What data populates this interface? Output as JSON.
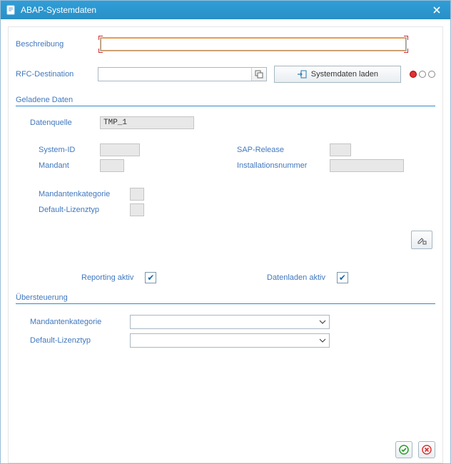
{
  "title": "ABAP-Systemdaten",
  "top": {
    "description_label": "Beschreibung",
    "description_value": "",
    "rfc_label": "RFC-Destination",
    "rfc_value": "",
    "load_button": "Systemdaten laden"
  },
  "loaded": {
    "section_title": "Geladene Daten",
    "datasource_label": "Datenquelle",
    "datasource_value": "TMP_1",
    "system_id_label": "System-ID",
    "system_id_value": "",
    "mandant_label": "Mandant",
    "mandant_value": "",
    "sap_release_label": "SAP-Release",
    "sap_release_value": "",
    "install_no_label": "Installationsnummer",
    "install_no_value": "",
    "mandant_cat_label": "Mandantenkategorie",
    "mandant_cat_value": "",
    "default_lic_label": "Default-Lizenztyp",
    "default_lic_value": ""
  },
  "checks": {
    "reporting_label": "Reporting aktiv",
    "reporting_checked": true,
    "dataload_label": "Datenladen aktiv",
    "dataload_checked": true
  },
  "override": {
    "section_title": "Übersteuerung",
    "mandant_cat_label": "Mandantenkategorie",
    "mandant_cat_value": "",
    "default_lic_label": "Default-Lizenztyp",
    "default_lic_value": ""
  }
}
